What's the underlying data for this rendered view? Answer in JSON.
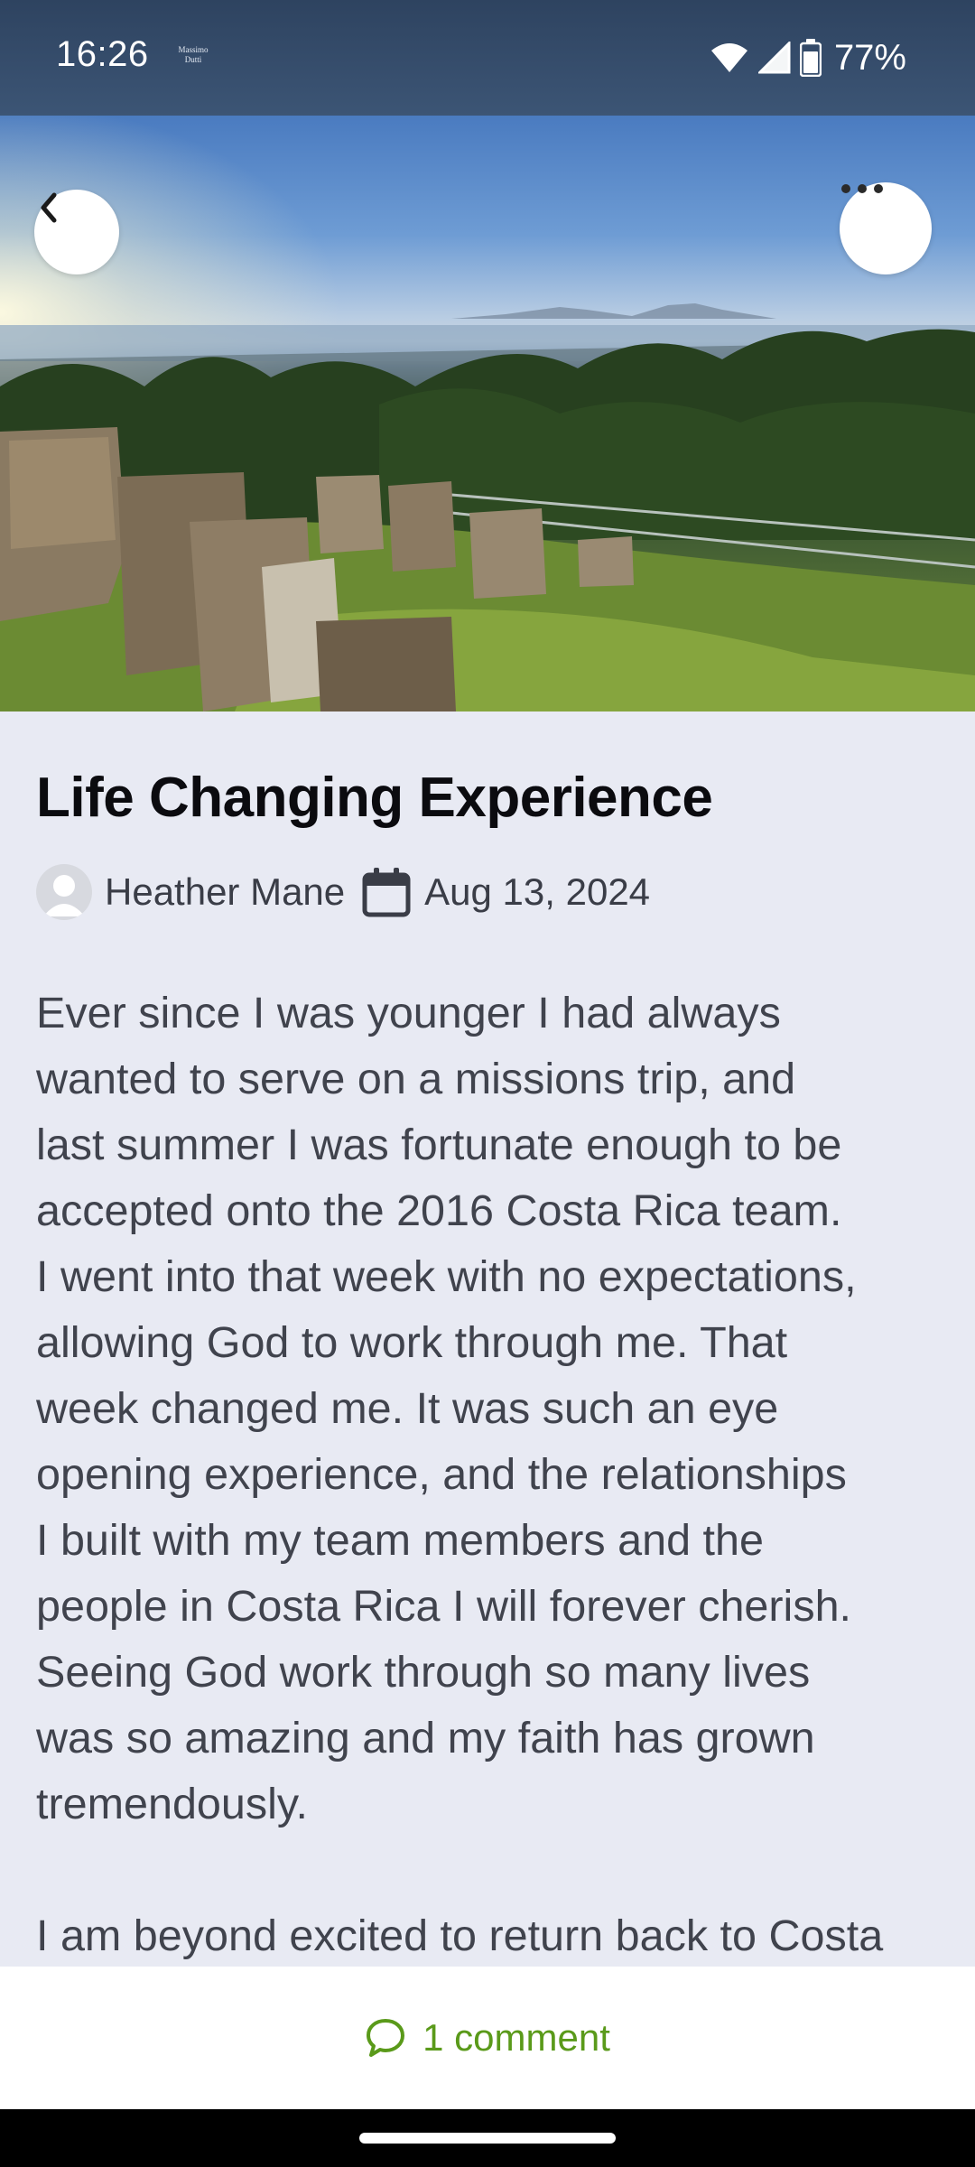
{
  "status_bar": {
    "time": "16:26",
    "notification_text": "Massimo Dutti",
    "battery_percent": "77%",
    "icons": [
      "wifi-icon",
      "cell-signal-icon",
      "battery-icon"
    ]
  },
  "header": {
    "back_icon": "chevron-left-icon",
    "more_icon": "more-horizontal-icon"
  },
  "article": {
    "title": "Life Changing Experience",
    "author": "Heather Mane",
    "date": "Aug 13, 2024",
    "paragraphs": [
      "Ever since I was younger I had always\nwanted to serve on a missions trip, and\nlast summer I was fortunate enough to be\naccepted onto the 2016 Costa Rica team.\nI went into that week with no expectations,\nallowing God to work through me. That\nweek changed me. It was such an eye\nopening experience, and the relationships\nI built with my team members and the\npeople in Costa Rica I will forever cherish.\nSeeing God work through so many lives\nwas so amazing and my faith has grown\ntremendously.",
      "I am beyond excited to return back to Costa"
    ]
  },
  "comments": {
    "label": "1 comment",
    "icon": "comment-bubble-icon"
  },
  "colors": {
    "accent": "#5a9a1a",
    "background": "#e8eaf3",
    "status_bar": "#34496a"
  }
}
